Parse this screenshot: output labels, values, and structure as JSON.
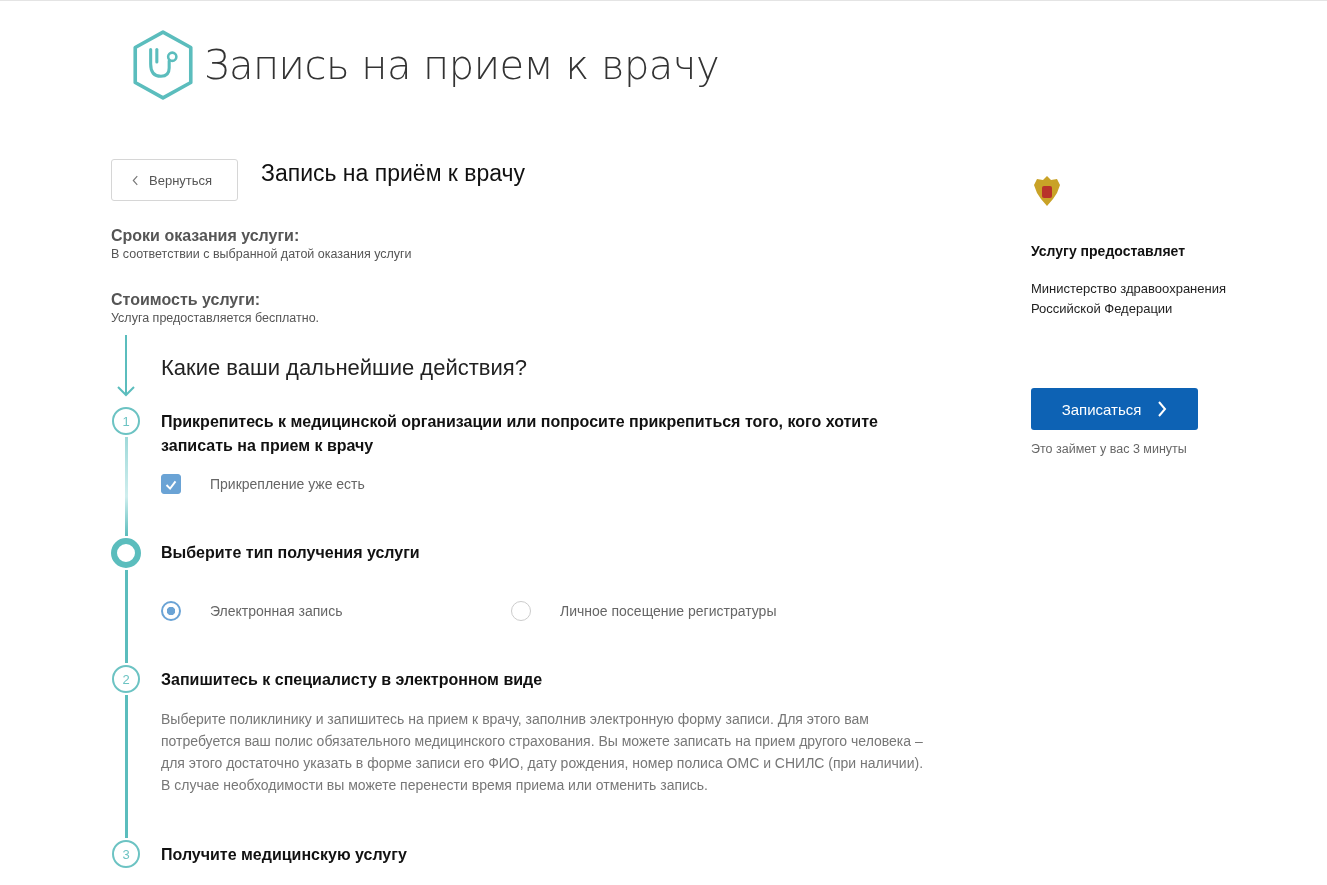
{
  "header": {
    "title": "Запись на прием к врачу"
  },
  "back_button": "Вернуться",
  "page_title": "Запись на приём к врачу",
  "info": [
    {
      "label": "Сроки оказания услуги:",
      "value": "В соответствии с выбранной датой оказания услуги"
    },
    {
      "label": "Стоимость услуги:",
      "value": "Услуга предоставляется бесплатно."
    }
  ],
  "steps_heading": "Какие ваши дальнейшие действия?",
  "steps": [
    {
      "kind": "numbered",
      "number": "1",
      "title": "Прикрепитесь к медицинской организации или попросите прикрепиться того, кого хотите записать на прием к врачу",
      "checkbox": {
        "label": "Прикрепление уже есть",
        "checked": true
      }
    },
    {
      "kind": "dot",
      "title": "Выберите тип получения услуги",
      "options": [
        {
          "label": "Электронная запись",
          "selected": true
        },
        {
          "label": "Личное посещение регистратуры",
          "selected": false
        }
      ]
    },
    {
      "kind": "numbered",
      "number": "2",
      "title": "Запишитесь к специалисту в электронном виде",
      "text": "Выберите поликлинику и запишитесь на прием к врачу, заполнив электронную форму записи. Для этого вам потребуется ваш полис обязательного медицинского страхования. Вы можете записать на прием другого человека – для этого достаточно указать в форме записи его ФИО, дату рождения, номер полиса ОМС и СНИЛС (при наличии). В случае необходимости вы можете перенести время приема или отменить запись."
    },
    {
      "kind": "numbered",
      "number": "3",
      "title": "Получите медицинскую услугу"
    }
  ],
  "provider": {
    "label": "Услугу предоставляет",
    "name": "Министерство здравоохранения Российской Федерации"
  },
  "cta": {
    "label": "Записаться",
    "note": "Это займет у вас 3 минуты"
  }
}
